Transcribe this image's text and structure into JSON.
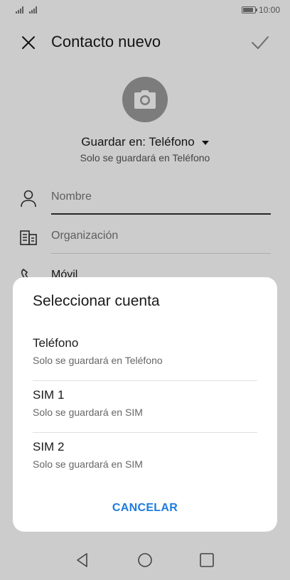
{
  "status_bar": {
    "time": "10:00"
  },
  "toolbar": {
    "title": "Contacto nuevo"
  },
  "account": {
    "save_in_label": "Guardar en: Teléfono",
    "save_in_subtitle": "Solo se guardará en Teléfono"
  },
  "fields": [
    {
      "label": "Nombre"
    },
    {
      "label": "Organización"
    },
    {
      "label": "Móvil"
    }
  ],
  "dialog": {
    "title": "Seleccionar cuenta",
    "options": [
      {
        "title": "Teléfono",
        "subtitle": "Solo se guardará en Teléfono"
      },
      {
        "title": "SIM 1",
        "subtitle": "Solo se guardará en SIM"
      },
      {
        "title": "SIM 2",
        "subtitle": "Solo se guardará en SIM"
      }
    ],
    "cancel_label": "CANCELAR"
  },
  "colors": {
    "accent": "#1e7be0",
    "scrim": "rgba(0,0,0,0.2)",
    "avatar_bg": "#9c9c9c"
  },
  "icons": [
    "close-icon",
    "check-icon",
    "camera-icon",
    "dropdown-caret-icon",
    "person-icon",
    "organization-icon",
    "phone-icon",
    "back-nav-icon",
    "home-nav-icon",
    "recents-nav-icon"
  ]
}
